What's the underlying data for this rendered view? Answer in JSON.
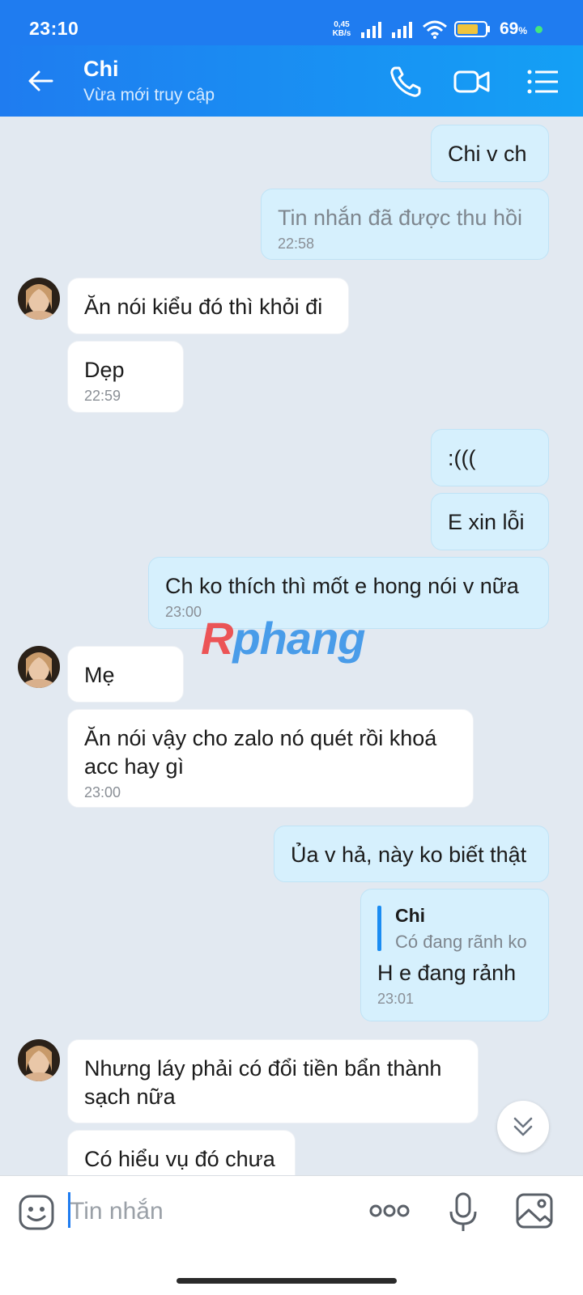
{
  "status_bar": {
    "time": "23:10",
    "net_speed_value": "0,45",
    "net_speed_unit": "KB/s",
    "battery_percent": "69",
    "battery_unit": "%"
  },
  "header": {
    "name": "Chi",
    "status": "Vừa mới truy cập",
    "icons": [
      "back-arrow-icon",
      "phone-icon",
      "video-camera-icon",
      "menu-list-icon"
    ]
  },
  "messages": [
    {
      "from": "me",
      "text": "Chi v ch"
    },
    {
      "from": "me",
      "text": "Tin nhắn đã được thu hồi",
      "time": "22:58",
      "recalled": true
    },
    {
      "from": "them",
      "text": "Ăn nói kiểu đó thì khỏi đi"
    },
    {
      "from": "them",
      "text": "Dẹp",
      "time": "22:59"
    },
    {
      "from": "me",
      "text": ":((("
    },
    {
      "from": "me",
      "text": "E xin lỗi"
    },
    {
      "from": "me",
      "text": "Ch ko thích thì mốt e hong nói v nữa",
      "time": "23:00"
    },
    {
      "from": "them",
      "text": "Mẹ"
    },
    {
      "from": "them",
      "text": "Ăn nói vậy cho zalo nó quét rồi khoá acc hay gì",
      "time": "23:00"
    },
    {
      "from": "me",
      "text": "Ủa v hả, này ko biết thật"
    },
    {
      "from": "me",
      "quote_author": "Chi",
      "quote_text": "Có đang rãnh ko",
      "text": "H e đang rảnh",
      "time": "23:01"
    },
    {
      "from": "them",
      "text": "Nhưng láy phải có đổi tiền bẩn thành sạch nữa"
    },
    {
      "from": "them",
      "text": "Có hiểu vụ đó chưa"
    }
  ],
  "watermark": {
    "first": "R",
    "rest": "phang"
  },
  "input": {
    "placeholder": "Tin nhắn"
  },
  "colors": {
    "primary": "#1f7cf0",
    "my_bubble": "#d6f0fd",
    "their_bubble": "#ffffff",
    "background": "#e2e9f1"
  }
}
